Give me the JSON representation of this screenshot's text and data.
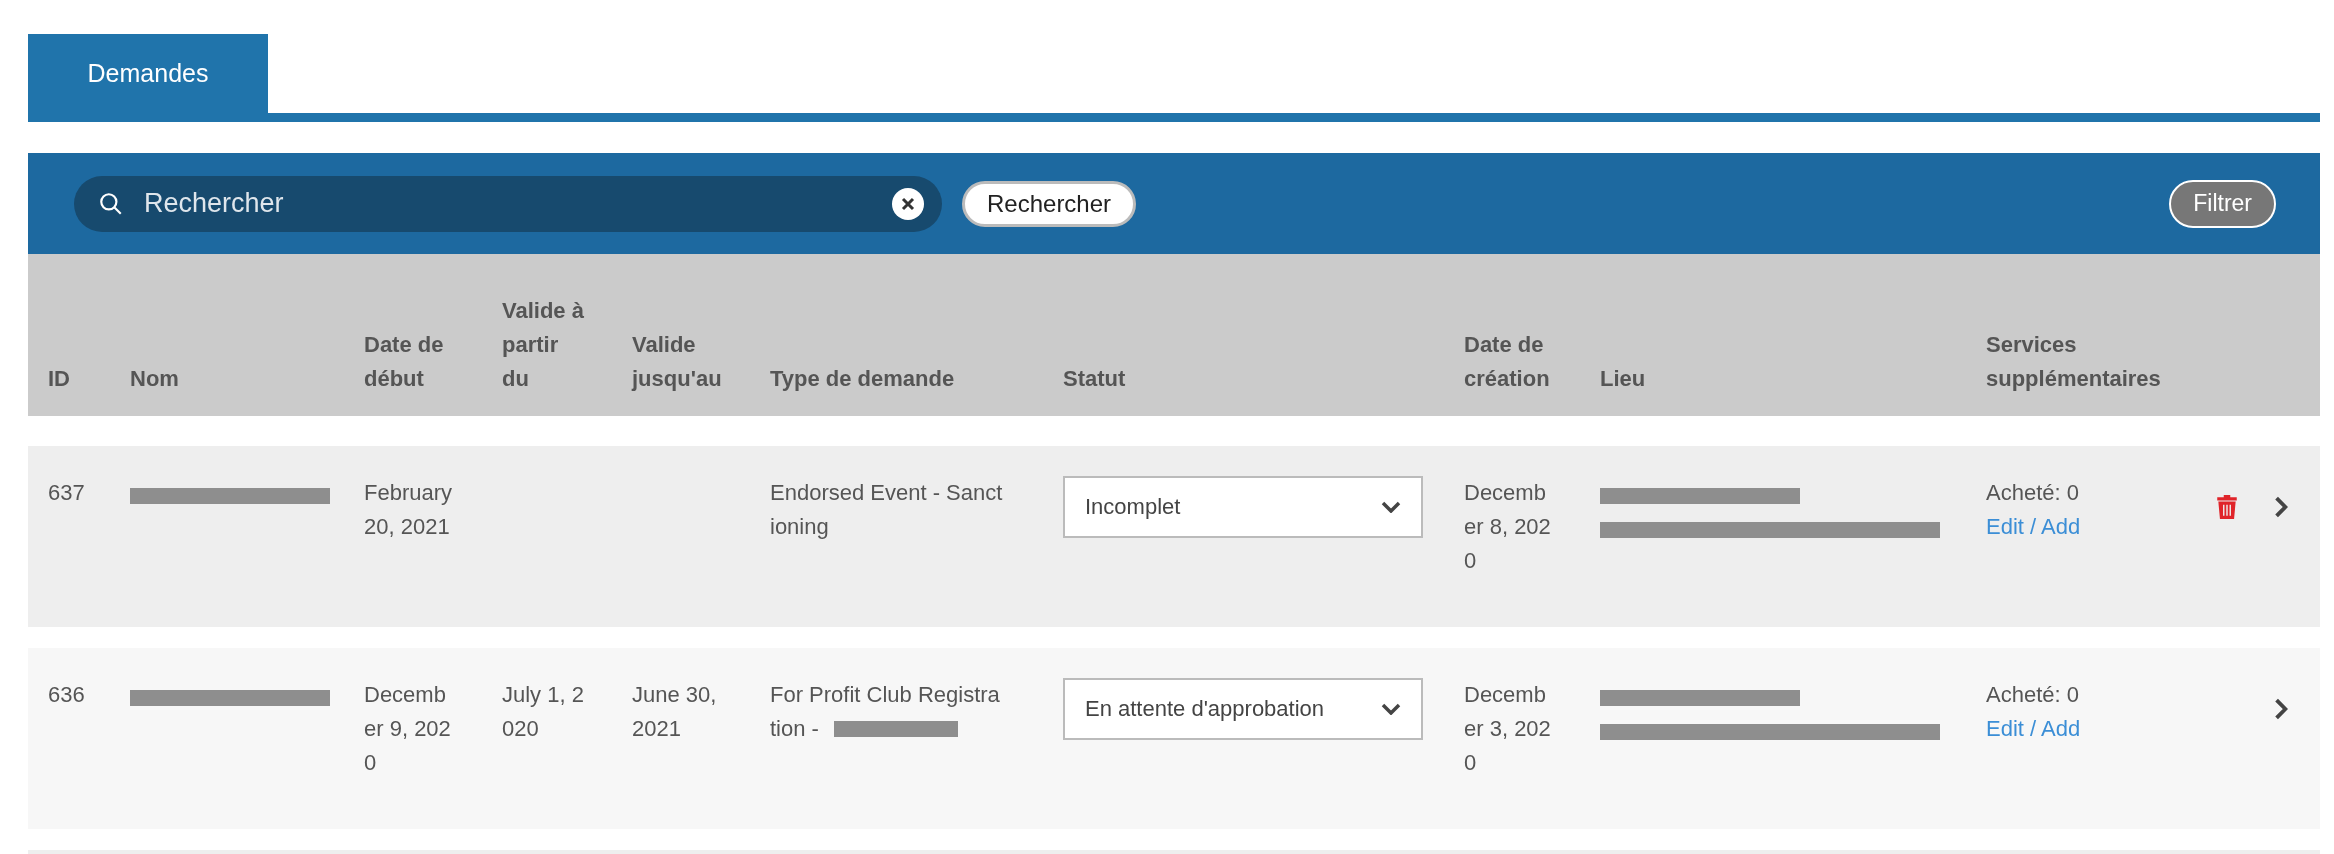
{
  "tabs": [
    {
      "label": "Demandes",
      "selected": true
    }
  ],
  "toolbar": {
    "search": {
      "placeholder": "Rechercher"
    },
    "search_button": "Rechercher",
    "filter_button": "Filtrer"
  },
  "table": {
    "columns": [
      "ID",
      "Nom",
      "Date de début",
      "Valide à partir du",
      "Valide jusqu'au",
      "Type de demande",
      "Statut",
      "Date de création",
      "Lieu",
      "Services supplémentaires"
    ],
    "rows": [
      {
        "id": "637",
        "name_redacted": true,
        "start": "February 20, 2021",
        "valid_from": "",
        "valid_to": "",
        "type": "Endorsed Event - Sanctioning",
        "type_redacted": false,
        "status": "Incomplet",
        "created": "December 8, 2020",
        "location_redacted": true,
        "purchased": "Acheté: 0",
        "link": "Edit / Add",
        "deletable": true
      },
      {
        "id": "636",
        "name_redacted": true,
        "start": "December 9, 2020",
        "valid_from": "July 1, 2020",
        "valid_to": "June 30, 2021",
        "type": "For Profit Club Registration -",
        "type_redacted": true,
        "status": "En attente d'approbation",
        "created": "December 3, 2020",
        "location_redacted": true,
        "purchased": "Acheté: 0",
        "link": "Edit / Add",
        "deletable": false
      }
    ]
  }
}
